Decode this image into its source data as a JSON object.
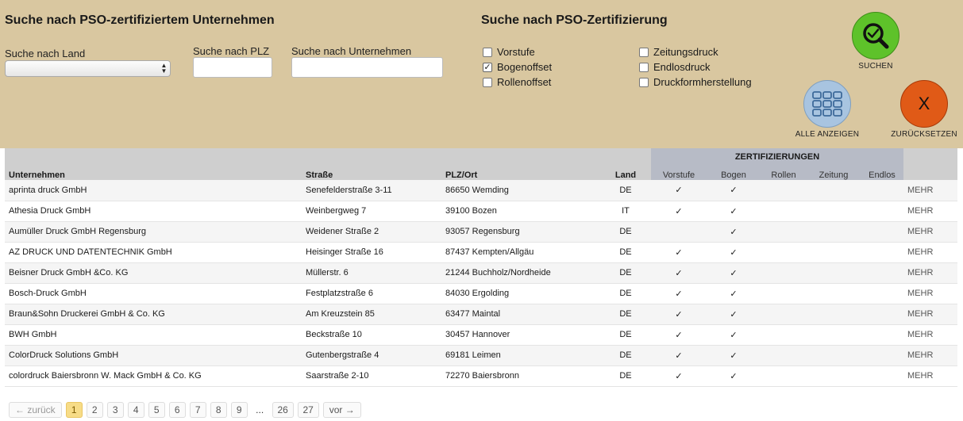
{
  "company_search": {
    "title": "Suche nach PSO-zertifiziertem Unternehmen",
    "country_label": "Suche nach Land",
    "country_value": "",
    "plz_label": "Suche nach PLZ",
    "plz_value": "",
    "company_label": "Suche nach Unternehmen",
    "company_value": ""
  },
  "cert_search": {
    "title": "Suche nach PSO-Zertifizierung",
    "options": [
      {
        "label": "Vorstufe",
        "checked": false
      },
      {
        "label": "Bogenoffset",
        "checked": true
      },
      {
        "label": "Rollenoffset",
        "checked": false
      },
      {
        "label": "Zeitungsdruck",
        "checked": false
      },
      {
        "label": "Endlosdruck",
        "checked": false
      },
      {
        "label": "Druckformherstellung",
        "checked": false
      }
    ]
  },
  "buttons": {
    "search_label": "SUCHEN",
    "show_all_label": "ALLE ANZEIGEN",
    "reset_label": "ZURÜCKSETZEN",
    "reset_glyph": "X",
    "colors": {
      "search": "#5ec22a",
      "show_all": "#a8c4e0",
      "reset": "#e05a17"
    }
  },
  "table": {
    "group_header": "ZERTIFIZIERUNGEN",
    "columns": {
      "company": "Unternehmen",
      "street": "Straße",
      "city": "PLZ/Ort",
      "country": "Land",
      "vorstufe": "Vorstufe",
      "bogen": "Bogen",
      "rollen": "Rollen",
      "zeitung": "Zeitung",
      "endlos": "Endlos"
    },
    "more_label": "MEHR",
    "check_glyph": "✓",
    "rows": [
      {
        "company": "aprinta druck GmbH",
        "street": "Senefelderstraße 3-11",
        "city": "86650 Wemding",
        "country": "DE",
        "vorstufe": "✓",
        "bogen": "✓",
        "rollen": "",
        "zeitung": "",
        "endlos": ""
      },
      {
        "company": "Athesia Druck GmbH",
        "street": "Weinbergweg 7",
        "city": "39100 Bozen",
        "country": "IT",
        "vorstufe": "✓",
        "bogen": "✓",
        "rollen": "",
        "zeitung": "",
        "endlos": ""
      },
      {
        "company": "Aumüller Druck GmbH Regensburg",
        "street": "Weidener Straße 2",
        "city": "93057 Regensburg",
        "country": "DE",
        "vorstufe": "",
        "bogen": "✓",
        "rollen": "",
        "zeitung": "",
        "endlos": ""
      },
      {
        "company": "AZ DRUCK UND DATENTECHNIK GmbH",
        "street": "Heisinger Straße 16",
        "city": "87437 Kempten/Allgäu",
        "country": "DE",
        "vorstufe": "✓",
        "bogen": "✓",
        "rollen": "",
        "zeitung": "",
        "endlos": ""
      },
      {
        "company": "Beisner Druck GmbH &Co. KG",
        "street": "Müllerstr. 6",
        "city": "21244 Buchholz/Nordheide",
        "country": "DE",
        "vorstufe": "✓",
        "bogen": "✓",
        "rollen": "",
        "zeitung": "",
        "endlos": ""
      },
      {
        "company": "Bosch-Druck GmbH",
        "street": "Festplatzstraße 6",
        "city": "84030 Ergolding",
        "country": "DE",
        "vorstufe": "✓",
        "bogen": "✓",
        "rollen": "",
        "zeitung": "",
        "endlos": ""
      },
      {
        "company": "Braun&Sohn Druckerei GmbH & Co. KG",
        "street": "Am Kreuzstein 85",
        "city": "63477 Maintal",
        "country": "DE",
        "vorstufe": "✓",
        "bogen": "✓",
        "rollen": "",
        "zeitung": "",
        "endlos": ""
      },
      {
        "company": "BWH GmbH",
        "street": "Beckstraße 10",
        "city": "30457 Hannover",
        "country": "DE",
        "vorstufe": "✓",
        "bogen": "✓",
        "rollen": "",
        "zeitung": "",
        "endlos": ""
      },
      {
        "company": "ColorDruck Solutions GmbH",
        "street": "Gutenbergstraße 4",
        "city": "69181 Leimen",
        "country": "DE",
        "vorstufe": "✓",
        "bogen": "✓",
        "rollen": "",
        "zeitung": "",
        "endlos": ""
      },
      {
        "company": "colordruck Baiersbronn W. Mack GmbH & Co. KG",
        "street": "Saarstraße 2-10",
        "city": "72270 Baiersbronn",
        "country": "DE",
        "vorstufe": "✓",
        "bogen": "✓",
        "rollen": "",
        "zeitung": "",
        "endlos": ""
      }
    ]
  },
  "pagination": {
    "prev_label": "← zurück",
    "next_label": "vor →",
    "ellipsis": "...",
    "current": "1",
    "pages": [
      "1",
      "2",
      "3",
      "4",
      "5",
      "6",
      "7",
      "8",
      "9"
    ],
    "tail_pages": [
      "26",
      "27"
    ]
  }
}
